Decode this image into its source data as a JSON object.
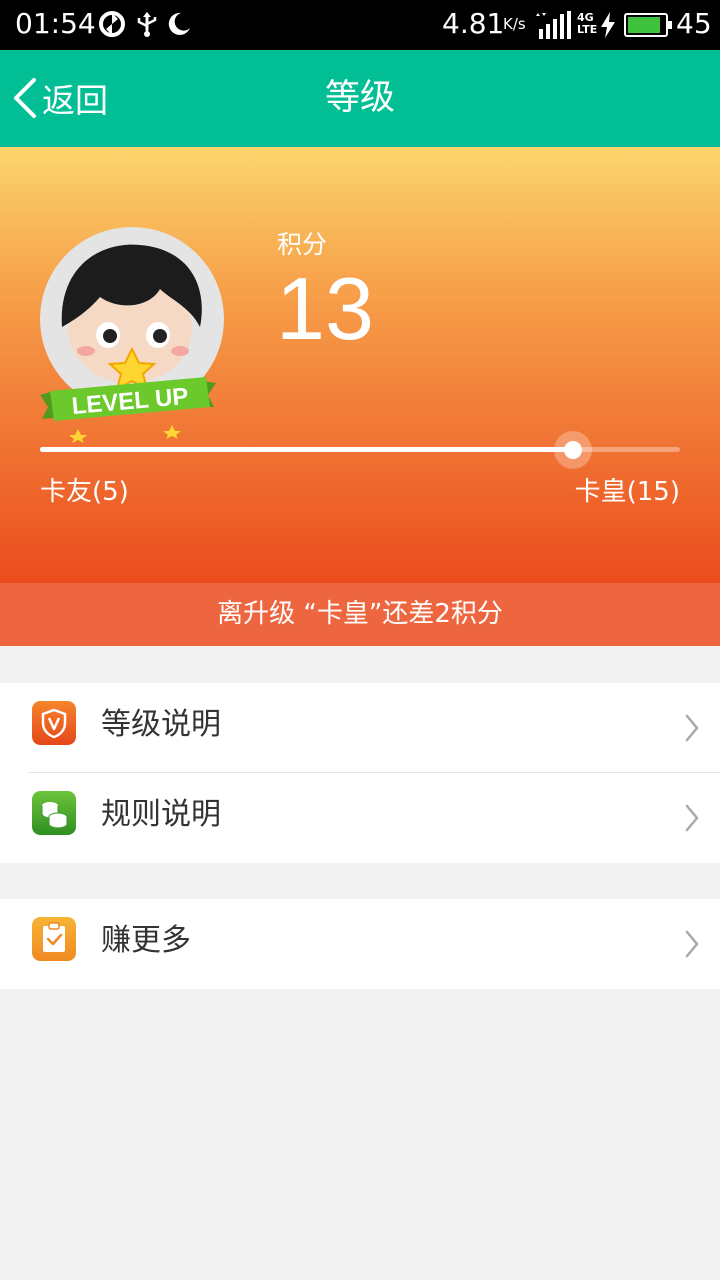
{
  "status_bar": {
    "time": "01:54",
    "net_speed": "4.81",
    "net_speed_unit": "K/s",
    "network_type": "4G",
    "network_sub": "LTE",
    "battery_level": "45",
    "battery_fraction": 0.9
  },
  "header": {
    "back_label": "返回",
    "title": "等级"
  },
  "hero": {
    "badge_text": "LEVEL UP",
    "points_label": "积分",
    "points_value": "13",
    "current_level": "卡友(5)",
    "next_level": "卡皇(15)",
    "progress_fraction": 0.833
  },
  "notice": {
    "text": "离升级 “卡皇”还差2积分"
  },
  "menu": {
    "group1": [
      {
        "label": "等级说明",
        "icon": "shield-v-icon",
        "color": "#ea5520"
      },
      {
        "label": "规则说明",
        "icon": "coins-icon",
        "color": "#3ca12a"
      }
    ],
    "group2": [
      {
        "label": "赚更多",
        "icon": "clipboard-check-icon",
        "color": "#f39524"
      }
    ]
  },
  "colors": {
    "title_bar": "#02be95",
    "notice_bar": "#ee6640",
    "background": "#f2f2f2"
  }
}
